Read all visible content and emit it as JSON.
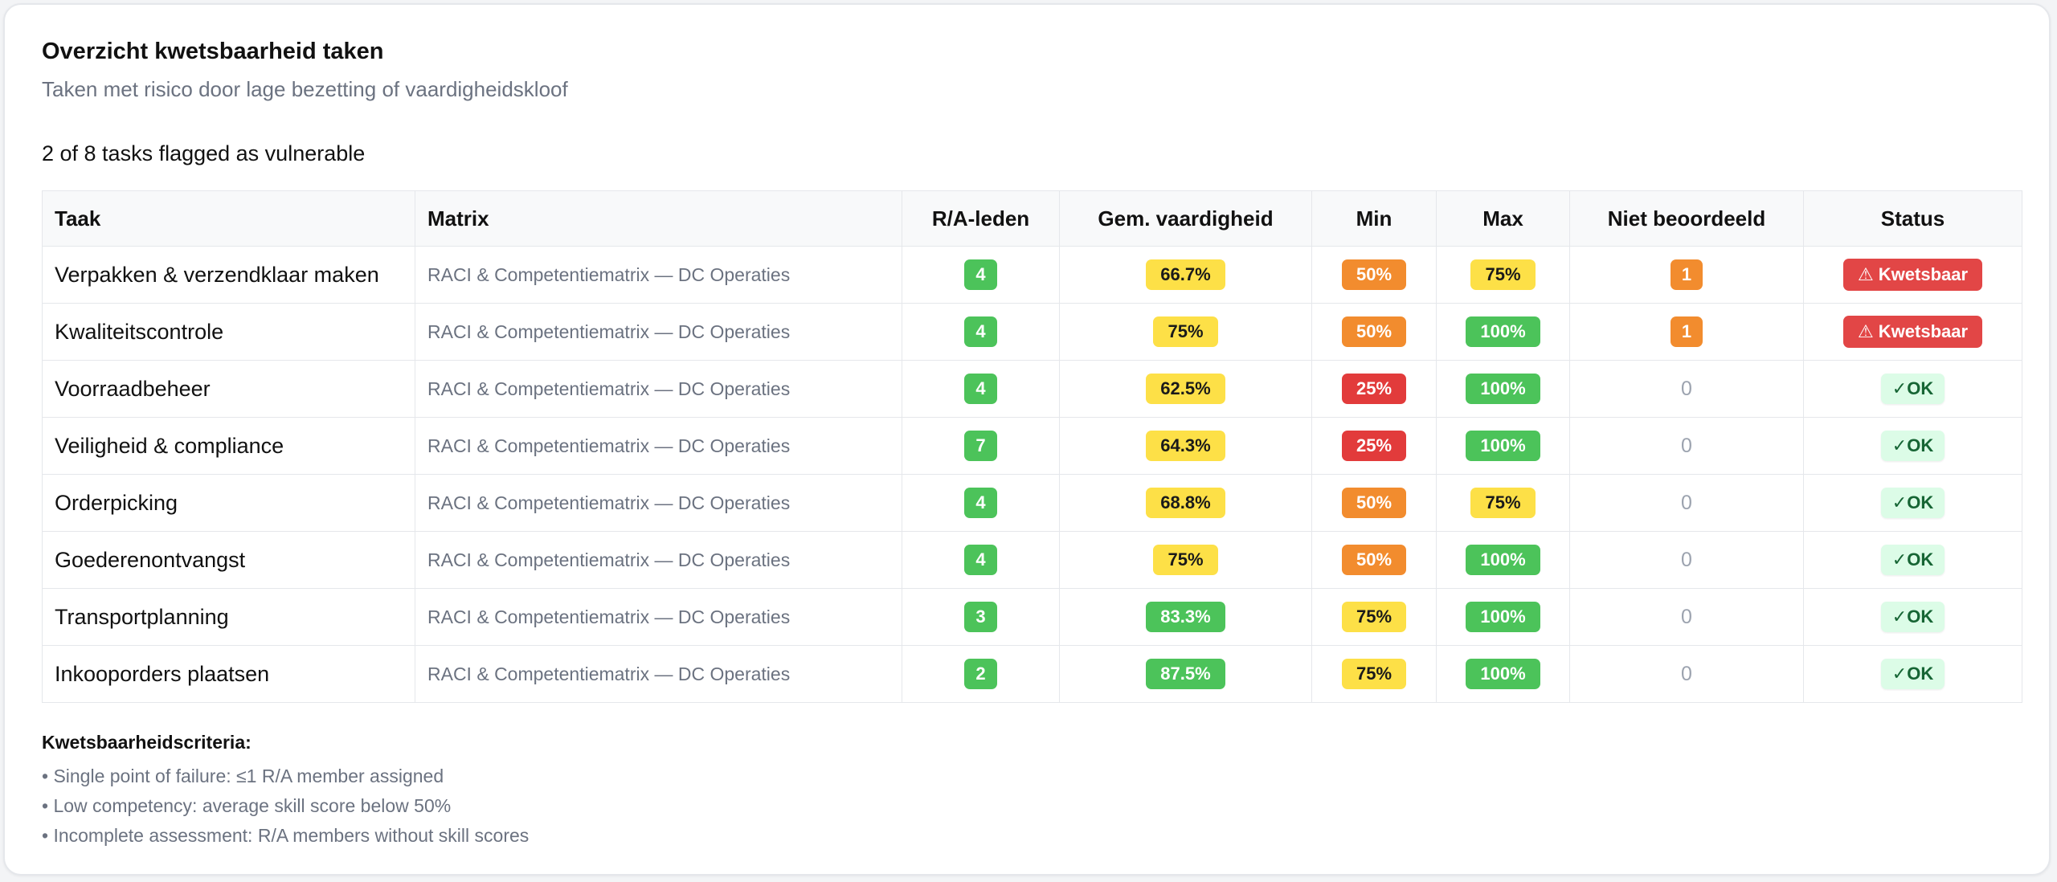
{
  "header": {
    "title": "Overzicht kwetsbaarheid taken",
    "subtitle": "Taken met risico door lage bezetting of vaardigheidskloof",
    "summary": "2 of 8 tasks flagged as vulnerable"
  },
  "table": {
    "columns": [
      "Taak",
      "Matrix",
      "R/A-leden",
      "Gem. vaardigheid",
      "Min",
      "Max",
      "Niet beoordeeld",
      "Status"
    ],
    "rows": [
      {
        "task": "Verpakken & verzendklaar maken",
        "matrix": "RACI & Competentiematrix — DC Operaties",
        "ra": "4",
        "avg": "66.7%",
        "avg_color": "yellow",
        "min": "50%",
        "min_color": "orange",
        "max": "75%",
        "max_color": "yellow",
        "unassessed": "1",
        "unassessed_flag": true,
        "status": "⚠ Kwetsbaar",
        "status_type": "vulnerable"
      },
      {
        "task": "Kwaliteitscontrole",
        "matrix": "RACI & Competentiematrix — DC Operaties",
        "ra": "4",
        "avg": "75%",
        "avg_color": "yellow",
        "min": "50%",
        "min_color": "orange",
        "max": "100%",
        "max_color": "green",
        "unassessed": "1",
        "unassessed_flag": true,
        "status": "⚠ Kwetsbaar",
        "status_type": "vulnerable"
      },
      {
        "task": "Voorraadbeheer",
        "matrix": "RACI & Competentiematrix — DC Operaties",
        "ra": "4",
        "avg": "62.5%",
        "avg_color": "yellow",
        "min": "25%",
        "min_color": "red",
        "max": "100%",
        "max_color": "green",
        "unassessed": "0",
        "unassessed_flag": false,
        "status": "✓OK",
        "status_type": "ok"
      },
      {
        "task": "Veiligheid & compliance",
        "matrix": "RACI & Competentiematrix — DC Operaties",
        "ra": "7",
        "avg": "64.3%",
        "avg_color": "yellow",
        "min": "25%",
        "min_color": "red",
        "max": "100%",
        "max_color": "green",
        "unassessed": "0",
        "unassessed_flag": false,
        "status": "✓OK",
        "status_type": "ok"
      },
      {
        "task": "Orderpicking",
        "matrix": "RACI & Competentiematrix — DC Operaties",
        "ra": "4",
        "avg": "68.8%",
        "avg_color": "yellow",
        "min": "50%",
        "min_color": "orange",
        "max": "75%",
        "max_color": "yellow",
        "unassessed": "0",
        "unassessed_flag": false,
        "status": "✓OK",
        "status_type": "ok"
      },
      {
        "task": "Goederenontvangst",
        "matrix": "RACI & Competentiematrix — DC Operaties",
        "ra": "4",
        "avg": "75%",
        "avg_color": "yellow",
        "min": "50%",
        "min_color": "orange",
        "max": "100%",
        "max_color": "green",
        "unassessed": "0",
        "unassessed_flag": false,
        "status": "✓OK",
        "status_type": "ok"
      },
      {
        "task": "Transportplanning",
        "matrix": "RACI & Competentiematrix — DC Operaties",
        "ra": "3",
        "avg": "83.3%",
        "avg_color": "green",
        "min": "75%",
        "min_color": "yellow",
        "max": "100%",
        "max_color": "green",
        "unassessed": "0",
        "unassessed_flag": false,
        "status": "✓OK",
        "status_type": "ok"
      },
      {
        "task": "Inkooporders plaatsen",
        "matrix": "RACI & Competentiematrix — DC Operaties",
        "ra": "2",
        "avg": "87.5%",
        "avg_color": "green",
        "min": "75%",
        "min_color": "yellow",
        "max": "100%",
        "max_color": "green",
        "unassessed": "0",
        "unassessed_flag": false,
        "status": "✓OK",
        "status_type": "ok"
      }
    ]
  },
  "criteria": {
    "title": "Kwetsbaarheidscriteria:",
    "items": [
      "• Single point of failure: ≤1 R/A member assigned",
      "• Low competency: average skill score below 50%",
      "• Incomplete assessment: R/A members without skill scores"
    ]
  },
  "colors": {
    "green": "#4cc35a",
    "yellow": "#fde047",
    "orange": "#f28c2e",
    "red": "#e23b3b",
    "vulnerable": "#e24646",
    "ok_bg": "#dcfce7"
  }
}
